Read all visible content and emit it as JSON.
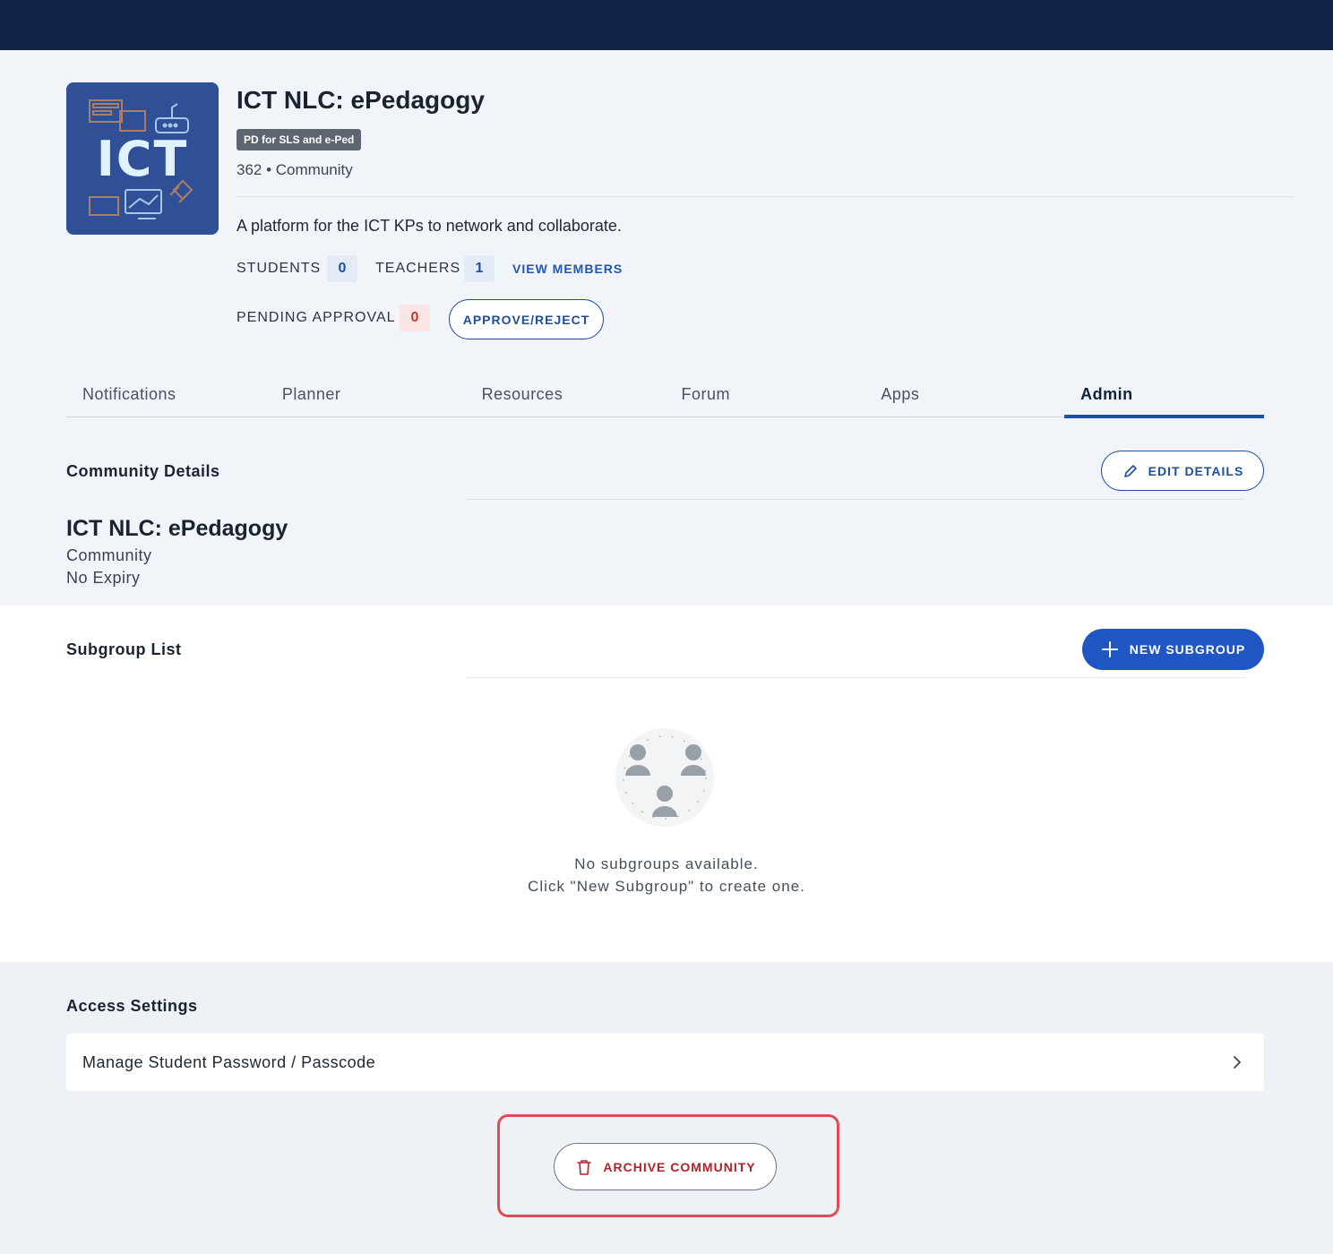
{
  "community": {
    "logo_text": "ICT",
    "title": "ICT NLC: ePedagogy",
    "tag": "PD for SLS and e-Ped",
    "meta": "362 • Community",
    "description": "A platform for the ICT KPs to network and collaborate."
  },
  "stats": {
    "students_label": "STUDENTS",
    "students_value": "0",
    "teachers_label": "TEACHERS",
    "teachers_value": "1",
    "view_members": "VIEW MEMBERS",
    "pending_label": "PENDING APPROVAL",
    "pending_value": "0",
    "approve_reject": "APPROVE/REJECT"
  },
  "tabs": [
    "Notifications",
    "Planner",
    "Resources",
    "Forum",
    "Apps",
    "Admin"
  ],
  "active_tab": "Admin",
  "community_details": {
    "heading": "Community Details",
    "edit_button": "EDIT DETAILS",
    "name": "ICT NLC: ePedagogy",
    "type": "Community",
    "expiry": "No Expiry"
  },
  "subgroup": {
    "heading": "Subgroup List",
    "new_button": "NEW SUBGROUP",
    "empty_line1": "No subgroups available.",
    "empty_line2": "Click \"New Subgroup\" to create one."
  },
  "access": {
    "heading": "Access Settings",
    "manage_password": "Manage Student Password / Passcode",
    "archive_button": "ARCHIVE COMMUNITY"
  },
  "colors": {
    "topbar": "#0e2345",
    "primary": "#1f56c4",
    "danger": "#b3202b",
    "highlight": "#e04b55"
  }
}
